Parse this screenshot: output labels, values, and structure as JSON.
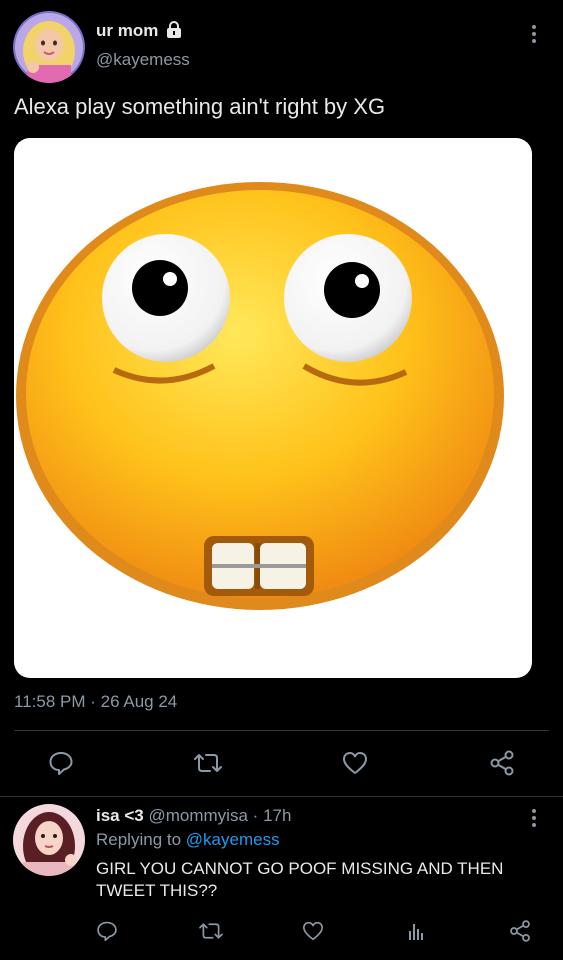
{
  "tweet": {
    "display_name": "ur mom",
    "handle": "@kayemess",
    "text": "Alexa play something ain't right by XG",
    "time": "11:58 PM",
    "separator": "·",
    "date": "26 Aug 24",
    "media_icon": "grimacing-emoji-image"
  },
  "reply": {
    "display_name": "isa <3",
    "handle": "@mommyisa",
    "separator": "·",
    "age": "17h",
    "replying_prefix": "Replying to",
    "replying_handle": "@kayemess",
    "text": "GIRL YOU CANNOT GO POOF MISSING AND THEN TWEET THIS??"
  },
  "colors": {
    "background": "#000000",
    "text": "#e7e9ea",
    "muted": "#8b98a5",
    "link": "#1d9bf0",
    "divider": "#2f3336"
  },
  "icons": {
    "lock": "lock-icon",
    "more": "more-vertical-icon",
    "reply": "reply-icon",
    "retweet": "retweet-icon",
    "like": "like-icon",
    "share": "share-icon",
    "analytics": "analytics-icon"
  }
}
